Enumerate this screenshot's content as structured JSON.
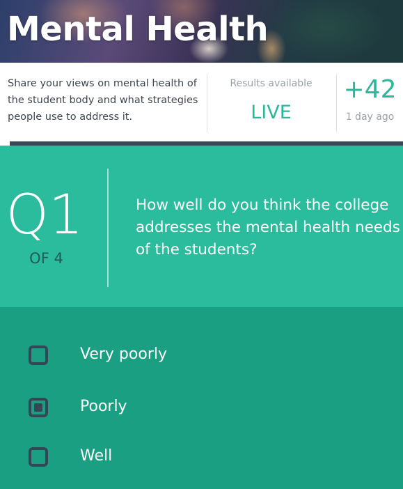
{
  "header": {
    "title": "Mental Health"
  },
  "info": {
    "description": "Share your views on mental health of the student body and what strategies people use to address it.",
    "results_label": "Results available",
    "results_value": "LIVE",
    "count": "+42",
    "time_ago": "1 day ago"
  },
  "progress": {
    "fraction": 0.025
  },
  "question": {
    "number": "Q1",
    "of_label": "OF 4",
    "text": "How well do you think the college addresses the mental health needs of the students?"
  },
  "options": [
    {
      "label": "Very poorly",
      "checked": false
    },
    {
      "label": "Poorly",
      "checked": true
    },
    {
      "label": "Well",
      "checked": false
    }
  ],
  "colors": {
    "accent": "#2bb799",
    "question_bg": "#2bbc9d",
    "answers_bg": "#1a9f83",
    "checkbox": "#364655"
  }
}
